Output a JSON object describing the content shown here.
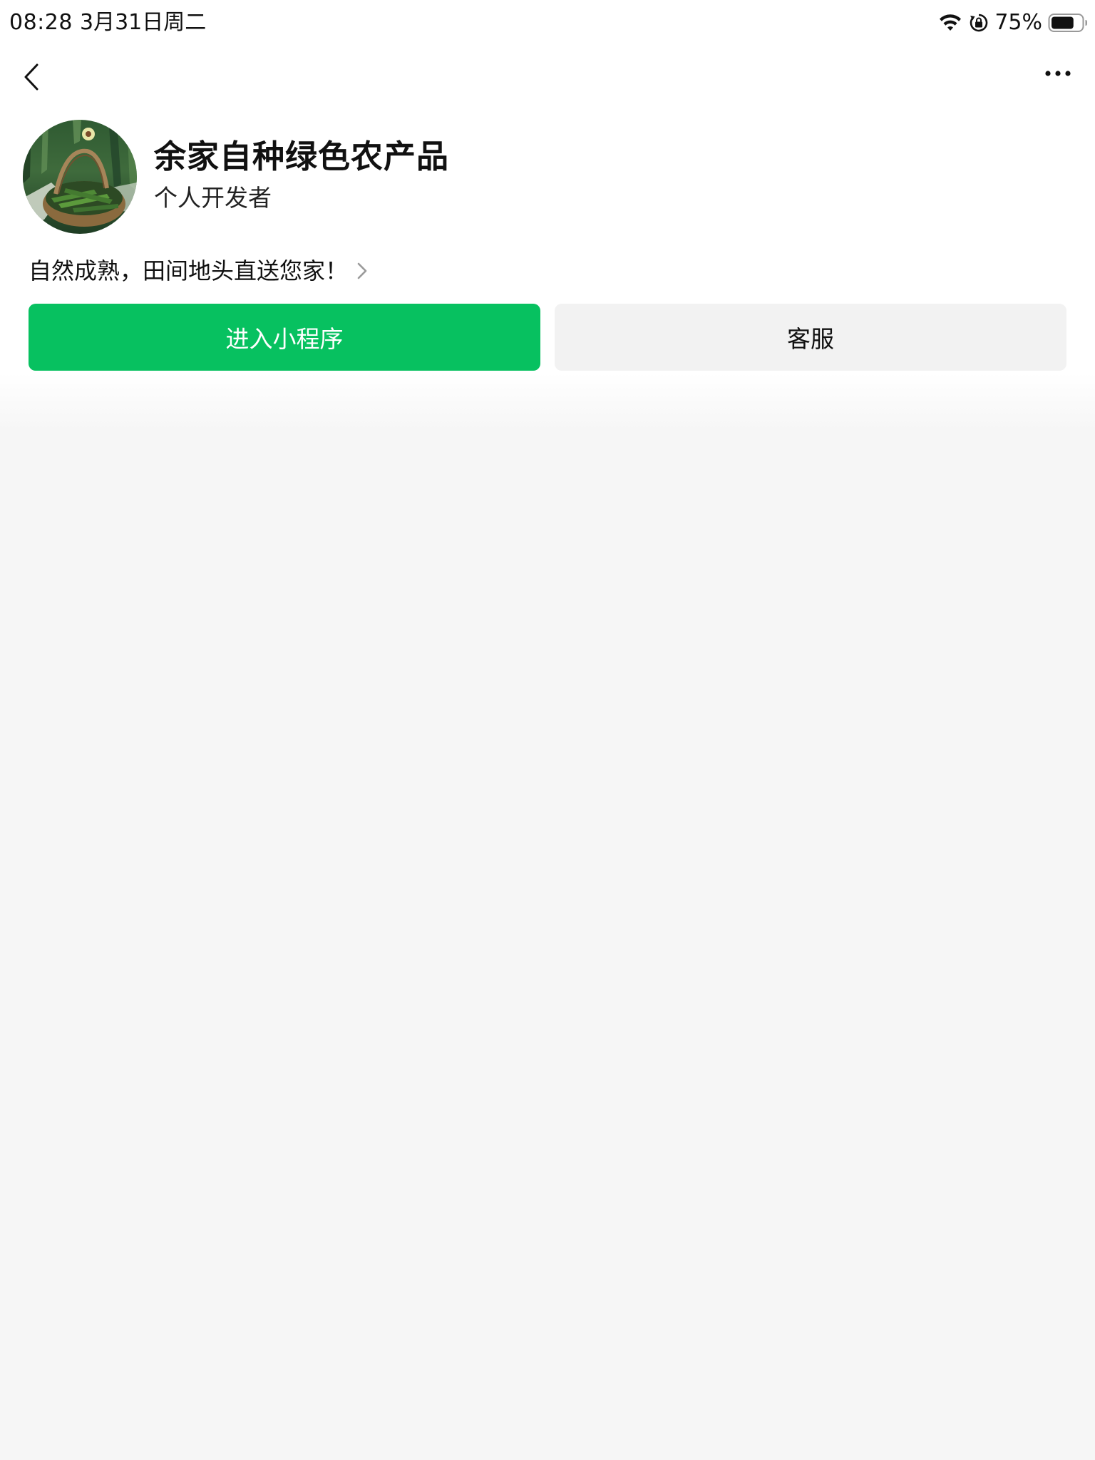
{
  "status_bar": {
    "time": "08:28",
    "date": "3月31日周二",
    "battery_percent": "75%",
    "battery_level": 0.75,
    "wifi_icon": "wifi-icon",
    "lock_icon": "orientation-lock-icon",
    "battery_icon": "battery-icon"
  },
  "nav": {
    "back_icon": "chevron-left-icon",
    "more_icon": "ellipsis-icon"
  },
  "profile": {
    "name": "余家自种绿色农产品",
    "developer_type": "个人开发者",
    "description": "自然成熟，田间地头直送您家！",
    "avatar_icon": "okra-basket-avatar"
  },
  "actions": {
    "enter_label": "进入小程序",
    "service_label": "客服"
  },
  "colors": {
    "primary": "#07c160",
    "secondary_bg": "#f2f2f2",
    "page_bg": "#f6f6f6"
  }
}
